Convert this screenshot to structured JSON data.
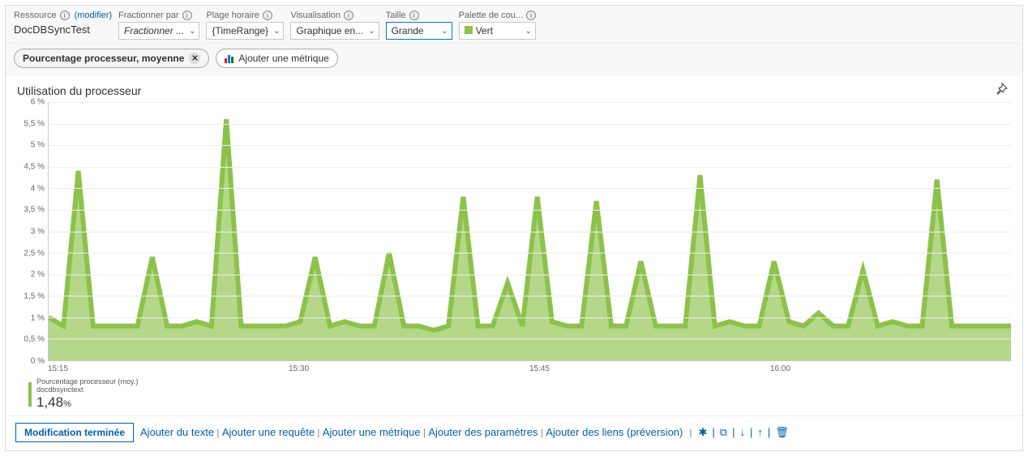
{
  "toolbar": {
    "resource": {
      "label": "Ressource",
      "modifier": "(modifier)",
      "name": "DocDBSyncTest"
    },
    "splitBy": {
      "label": "Fractionner par",
      "value": "Fractionner ..."
    },
    "timeRange": {
      "label": "Plage horaire",
      "value": "{TimeRange}"
    },
    "visualization": {
      "label": "Visualisation",
      "value": "Graphique en..."
    },
    "size": {
      "label": "Taille",
      "value": "Grande"
    },
    "palette": {
      "label": "Palette de cou...",
      "value": "Vert"
    }
  },
  "pills": {
    "metric": "Pourcentage processeur, moyenne",
    "addMetric": "Ajouter une métrique"
  },
  "chart": {
    "title": "Utilisation du processeur"
  },
  "legend": {
    "series": "Pourcentage processeur (moy.)",
    "resource": "docdbsynctext",
    "value": "1,48",
    "unit": "%"
  },
  "footer": {
    "done": "Modification terminée",
    "links": [
      "Ajouter du texte",
      "Ajouter une requête",
      "Ajouter une métrique",
      "Ajouter des paramètres",
      "Ajouter des liens (préversion)"
    ]
  },
  "chart_data": {
    "type": "area",
    "title": "Utilisation du processeur",
    "ylabel": "%",
    "ylim": [
      0,
      6
    ],
    "yticks": [
      0,
      0.5,
      1,
      1.5,
      2,
      2.5,
      3,
      3.5,
      4,
      4.5,
      5,
      5.5,
      6
    ],
    "ytick_labels": [
      "0 %",
      "0,5 %",
      "1 %",
      "1,5 %",
      "2 %",
      "2,5 %",
      "3 %",
      "3,5 %",
      "4 %",
      "4,5 %",
      "5 %",
      "5,5 %",
      "6 %"
    ],
    "xticks": [
      "15:15",
      "15:30",
      "15:45",
      "16:00"
    ],
    "series": [
      {
        "name": "Pourcentage processeur (moy.)",
        "color": "#8CC24A",
        "values": [
          1.0,
          0.8,
          4.4,
          0.8,
          0.8,
          0.8,
          0.8,
          2.4,
          0.8,
          0.8,
          0.9,
          0.8,
          5.6,
          0.8,
          0.8,
          0.8,
          0.8,
          0.9,
          2.4,
          0.8,
          0.9,
          0.8,
          0.8,
          2.5,
          0.8,
          0.8,
          0.7,
          0.8,
          3.8,
          0.8,
          0.8,
          1.8,
          0.8,
          3.8,
          0.9,
          0.8,
          0.8,
          3.7,
          0.8,
          0.8,
          2.3,
          0.8,
          0.8,
          0.8,
          4.3,
          0.8,
          0.9,
          0.8,
          0.8,
          2.3,
          0.9,
          0.8,
          1.1,
          0.8,
          0.8,
          2.1,
          0.8,
          0.9,
          0.8,
          0.8,
          4.2,
          0.8,
          0.8,
          0.8,
          0.8,
          0.8
        ]
      }
    ]
  }
}
